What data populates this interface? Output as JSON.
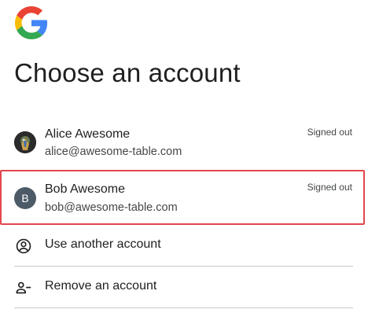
{
  "logo": {
    "icon": "google-g-logo"
  },
  "heading": {
    "title": "Choose an account"
  },
  "accounts": [
    {
      "name": "Alice Awesome",
      "email": "alice@awesome-table.com",
      "status": "Signed out",
      "avatar": {
        "type": "photo",
        "icon": "avatar-photo"
      }
    },
    {
      "name": "Bob Awesome",
      "email": "bob@awesome-table.com",
      "status": "Signed out",
      "avatar": {
        "type": "initial",
        "initial": "B",
        "color": "#4d5b68"
      }
    }
  ],
  "actions": {
    "use_another": {
      "label": "Use another account",
      "icon": "account-circle-icon"
    },
    "remove": {
      "label": "Remove an account",
      "icon": "person-remove-icon"
    }
  },
  "colors": {
    "highlight_border": "#e3474d",
    "google_blue": "#4285F4",
    "google_red": "#EA4335",
    "google_yellow": "#FBBC05",
    "google_green": "#34A853"
  }
}
